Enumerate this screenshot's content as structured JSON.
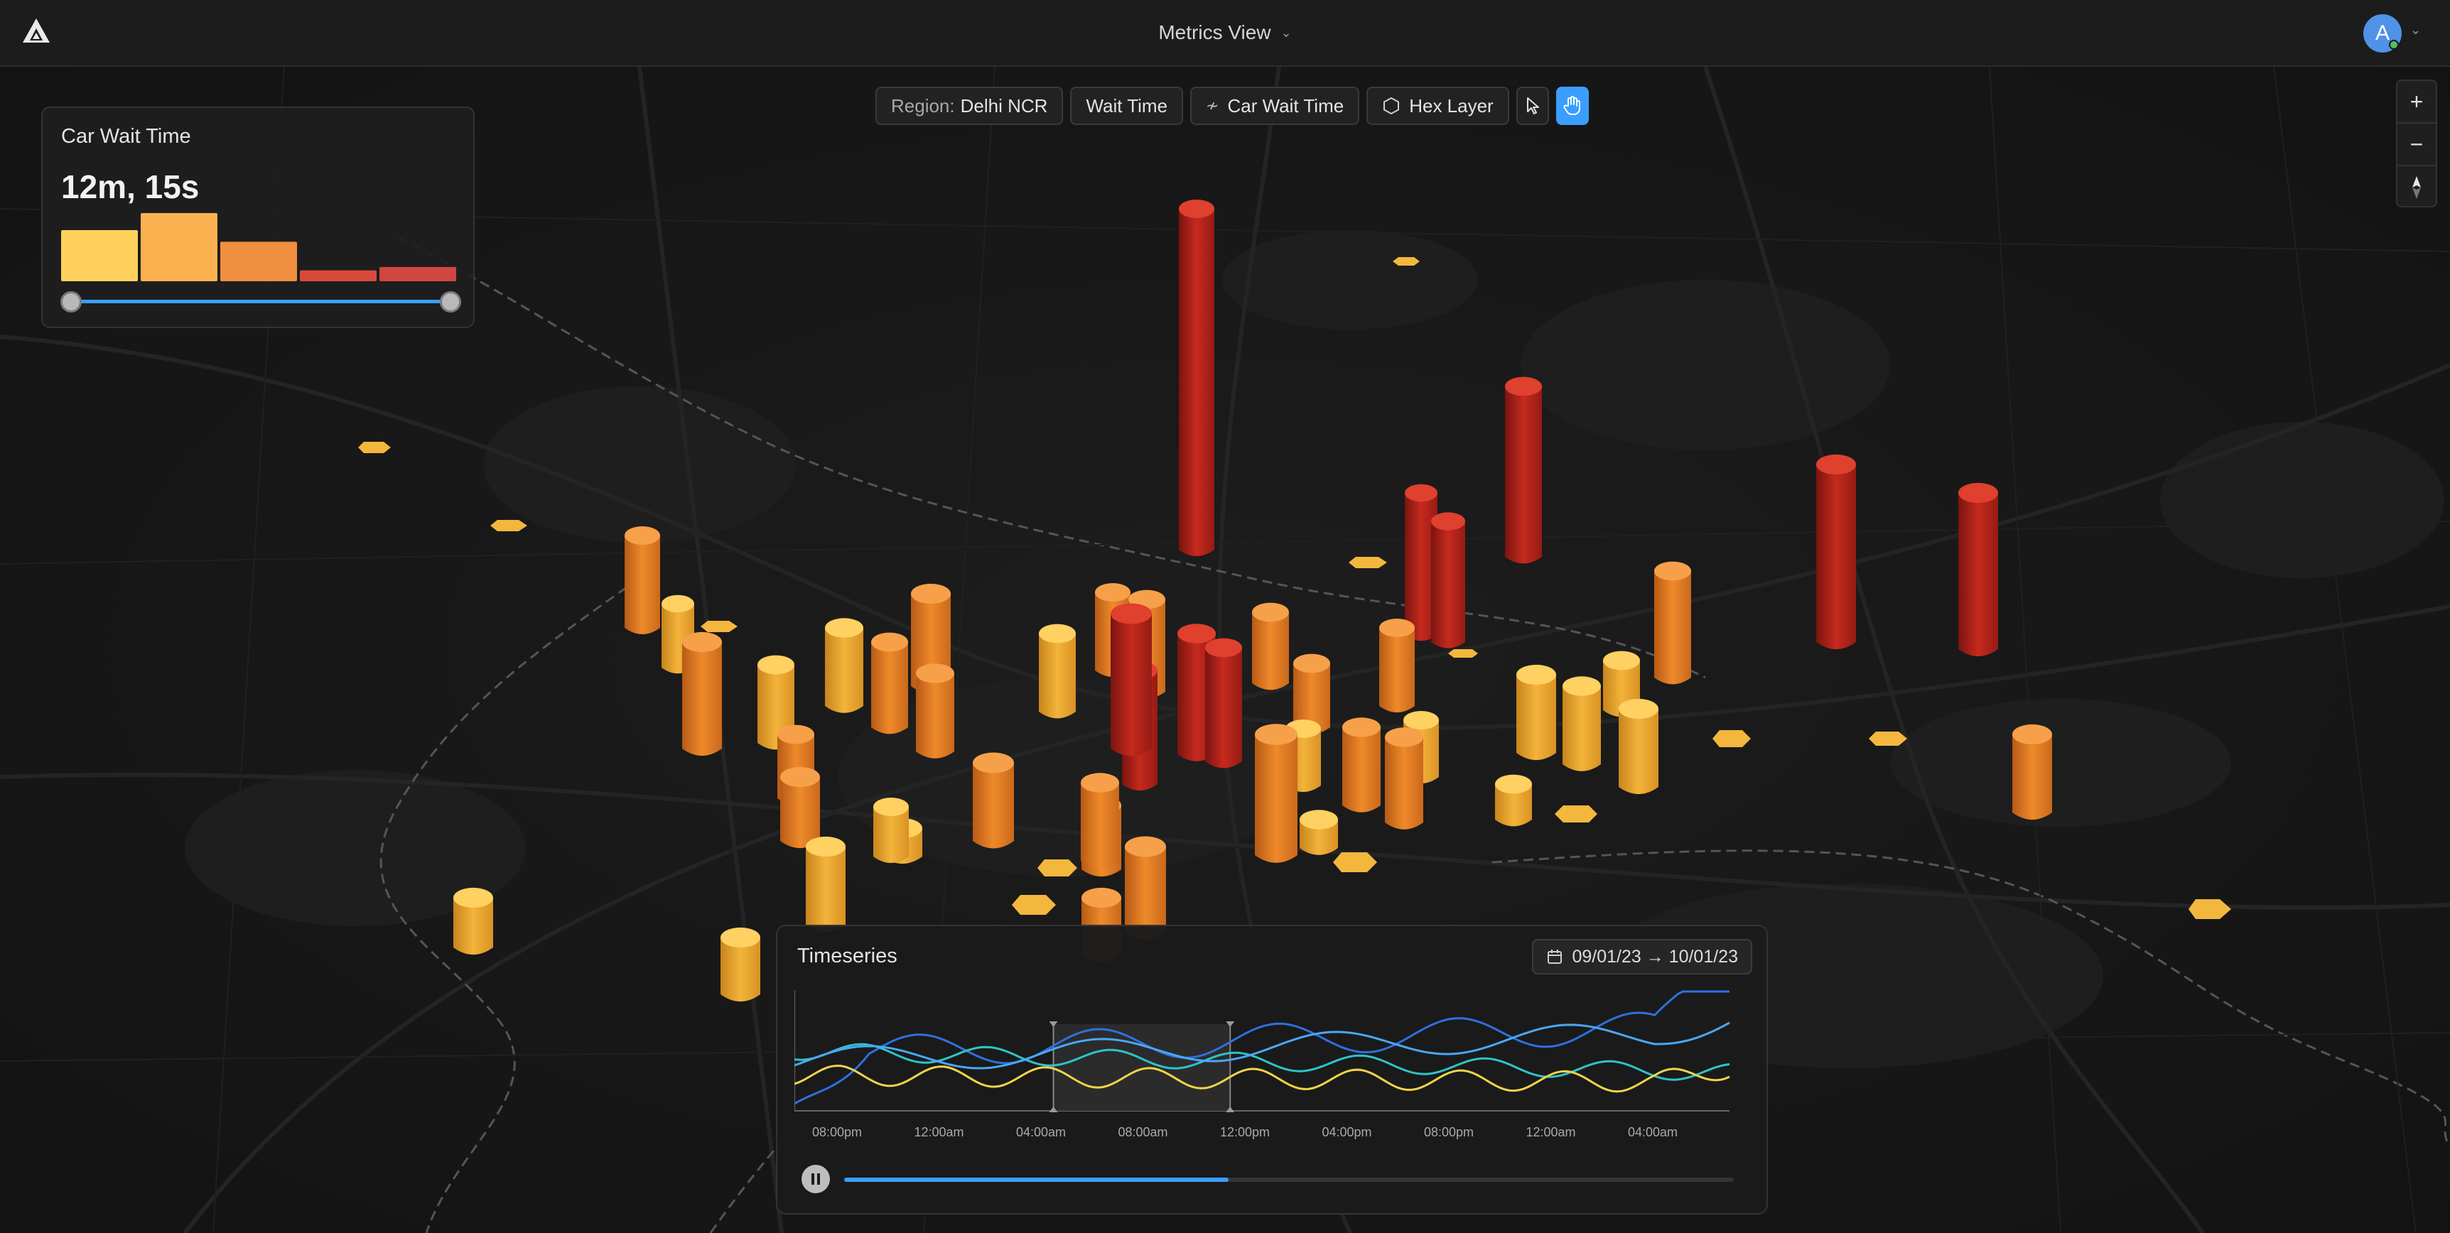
{
  "app": {
    "title": "Metrics View",
    "user_initial": "A"
  },
  "toolbar": {
    "region_label": "Region:",
    "region_value": "Delhi NCR",
    "metric": "Wait Time",
    "layer_metric": "Car Wait Time",
    "layer_type": "Hex Layer"
  },
  "legend": {
    "title": "Car Wait Time",
    "value": "12m, 15s",
    "histogram": [
      {
        "value": 0.75,
        "color": "#ffd15c"
      },
      {
        "value": 1.0,
        "color": "#fbb14f"
      },
      {
        "value": 0.58,
        "color": "#ef8f3f"
      },
      {
        "value": 0.16,
        "color": "#d84a3c"
      },
      {
        "value": 0.21,
        "color": "#cf4740"
      }
    ],
    "range_fraction": [
      0.0,
      1.0
    ]
  },
  "timeseries": {
    "title": "Timeseries",
    "date_range": "09/01/23 → 10/01/23",
    "x_ticks": [
      "08:00pm",
      "12:00am",
      "04:00am",
      "08:00am",
      "12:00pm",
      "04:00pm",
      "08:00pm",
      "12:00am",
      "04:00am"
    ],
    "series_colors": [
      "#2f6fe0",
      "#2ec4c8",
      "#f0d44a",
      "#4aa8f5"
    ],
    "selection_fraction": [
      0.277,
      0.466
    ],
    "progress_fraction": 0.432
  },
  "colors": {
    "accent": "#3b9eff",
    "low": "#f6c343",
    "mid": "#ef8a2a",
    "high": "#c62a1e"
  }
}
